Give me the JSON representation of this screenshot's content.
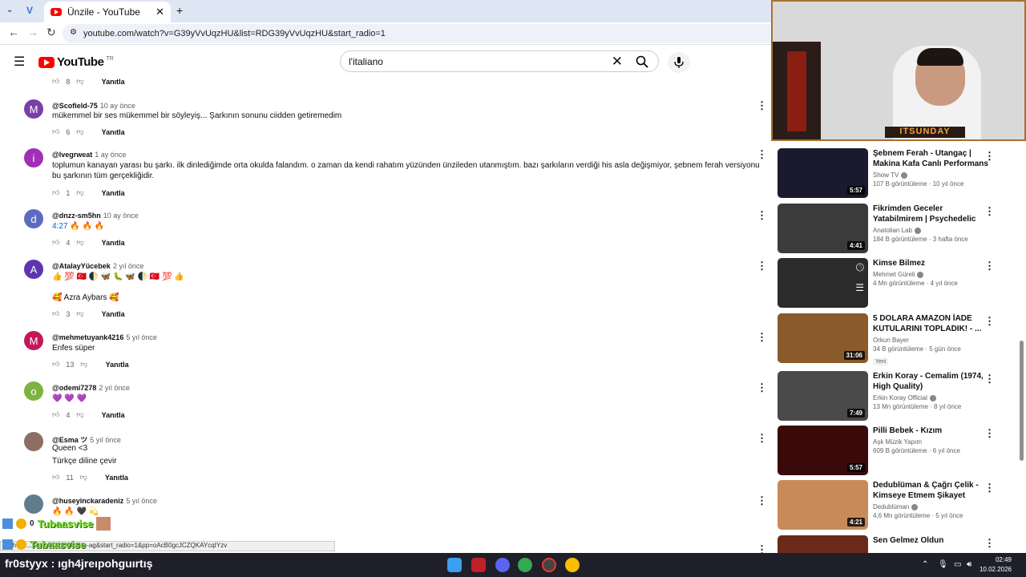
{
  "browser": {
    "tab_title": "Ünzile - YouTube",
    "url": "youtube.com/watch?v=G39yVvUqzHU&list=RDG39yVvUqzHU&start_radio=1"
  },
  "youtube": {
    "logo_text": "YouTube",
    "region": "TR",
    "search_value": "l'italiano"
  },
  "comments": {
    "reply_label": "Yanıtla",
    "top_likes": "8",
    "items": [
      {
        "avatar": "M",
        "user": "@Scofield-75",
        "time": "10 ay önce",
        "lines": [
          "mükemmel bir ses mükemmel bir söyleyiş... Şarkının sonunu ciidden getiremedim"
        ],
        "likes": "6",
        "color": "#7b3fa8"
      },
      {
        "avatar": "i",
        "user": "@lvegrweat",
        "time": "1 ay önce",
        "lines": [
          "toplumun kanayan yarası bu şarkı. ilk dinlediğimde orta okulda falandım. o zaman da kendi rahatım yüzünden ünzileden utanmıştım. bazı şarkıların verdiği his asla değişmiyor, şebnem ferah versiyonu bu şarkının tüm gerçekliğidir."
        ],
        "likes": "1",
        "color": "#a12fb8"
      },
      {
        "avatar": "d",
        "user": "@dnzz-sm5hn",
        "time": "10 ay önce",
        "timestamp": "4:27",
        "lines": [
          "🔥 🔥 🔥"
        ],
        "likes": "4",
        "color": "#5c6bc0"
      },
      {
        "avatar": "A",
        "user": "@AtalayYücebek",
        "time": "2 yıl önce",
        "lines": [
          "👍 💯 🇹🇷 🌓 🦋 🐛 🦋 🌓 🇹🇷 💯 👍",
          "",
          "🥰 Azra Aybars 🥰"
        ],
        "likes": "3",
        "color": "#5e35b1"
      },
      {
        "avatar": "M",
        "user": "@mehmetuyank4216",
        "time": "5 yıl önce",
        "lines": [
          "Enfes süper"
        ],
        "likes": "13",
        "color": "#c2185b"
      },
      {
        "avatar": "o",
        "user": "@odemi7278",
        "time": "2 yıl önce",
        "lines": [
          "💜 💜 💜"
        ],
        "likes": "4",
        "color": "#7cb342"
      },
      {
        "avatar": "",
        "user": "@Esma ツ",
        "time": "5 yıl önce",
        "lines": [
          "Queen <3",
          "Türkçe diline çevir"
        ],
        "likes": "11",
        "color": "#8d6e63"
      },
      {
        "avatar": "",
        "user": "@huseyinckaradeniz",
        "time": "5 yıl önce",
        "lines": [
          "🔥 🔥 🖤 💫"
        ],
        "likes": "",
        "color": "#607d8b"
      }
    ]
  },
  "webcam": {
    "label": "ITSUNDAY"
  },
  "recommendations": [
    {
      "title": "Şebnem Ferah - Utangaç | Makina Kafa Canlı Performans",
      "channel": "Show TV",
      "verified": true,
      "stats": "107 B görüntüleme · 10 yıl önce",
      "duration": "5:57",
      "thumb": "#1a1a2e"
    },
    {
      "title": "Fikrimden Geceler Yatabilmirem | Psychedelic Anatolian Rock ...",
      "channel": "Anatolian Lab",
      "verified": true,
      "stats": "184 B görüntüleme · 3 hafta önce",
      "duration": "4:41",
      "thumb": "#3b3b3b"
    },
    {
      "title": "Kimse Bilmez",
      "channel": "Mehmet Güreli",
      "verified": true,
      "stats": "4 Mn görüntüleme · 4 yıl önce",
      "duration": "",
      "thumb": "#2b2b2b"
    },
    {
      "title": "5 DOLARA AMAZON İADE KUTULARINI TOPLADIK! - ...",
      "channel": "Orkun Bayer",
      "verified": false,
      "stats": "34 B görüntüleme · 5 gün önce",
      "badge": "Yeni",
      "duration": "31:06",
      "thumb": "#8a5a2a"
    },
    {
      "title": "Erkin Koray - Cemalim (1974, High Quality)",
      "channel": "Erkin Koray Official",
      "verified": true,
      "stats": "13 Mn görüntüleme · 8 yıl önce",
      "duration": "7:49",
      "thumb": "#4a4a4a"
    },
    {
      "title": "Pilli Bebek - Kızım",
      "channel": "Aşk Müzik Yapım",
      "verified": false,
      "stats": "609 B görüntüleme · 6 yıl önce",
      "duration": "5:57",
      "thumb": "#3a0a0a"
    },
    {
      "title": "Dedublüman & Çağrı Çelik - Kimseye Etmem Şikayet",
      "channel": "Dedublüman",
      "verified": true,
      "stats": "4,6 Mn görüntüleme · 5 yıl önce",
      "duration": "4:21",
      "thumb": "#c98a5a"
    },
    {
      "title": "Sen Gelmez Oldun",
      "channel": "",
      "verified": false,
      "stats": "",
      "duration": "",
      "thumb": "#6a2a1a"
    }
  ],
  "overlay": {
    "chat_name": "Tubaasvise",
    "chat_prefix": "0",
    "status_url": "...ch?v=...&list=RD2EVTq8xk-ag&start_radio=1&pp=oAcB0gcJCZQKAYcqIYzv"
  },
  "taskbar": {
    "user": "fr0styyx",
    "message": ": ıgh4jreıpohguırtış",
    "time": "02:49",
    "date": "10.02.2026"
  }
}
